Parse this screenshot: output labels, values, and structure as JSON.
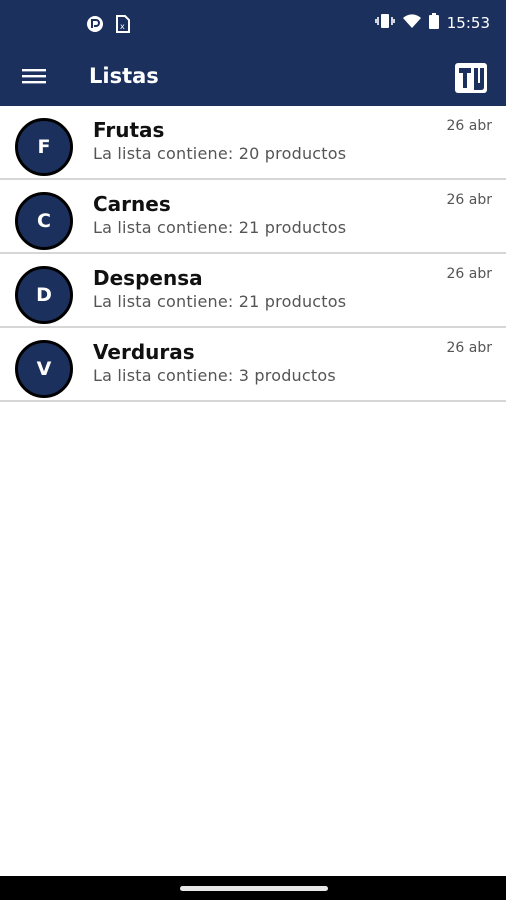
{
  "status_bar": {
    "time": "15:53",
    "icons": [
      "app-notification-icon",
      "sim-card-icon",
      "vibrate-icon",
      "wifi-icon",
      "battery-icon"
    ]
  },
  "app_bar": {
    "title": "Listas",
    "menu_icon": "hamburger-menu-icon",
    "logo_icon": "app-logo-icon",
    "background": "#1c305e"
  },
  "lists": [
    {
      "initial": "F",
      "name": "Frutas",
      "subtitle_prefix": "La lista contiene:",
      "subtitle_count": "20 productos",
      "date": "26 abr"
    },
    {
      "initial": "C",
      "name": "Carnes",
      "subtitle_prefix": "La lista contiene:",
      "subtitle_count": "21 productos",
      "date": "26 abr"
    },
    {
      "initial": "D",
      "name": "Despensa",
      "subtitle_prefix": "La lista contiene:",
      "subtitle_count": "21 productos",
      "date": "26 abr"
    },
    {
      "initial": "V",
      "name": "Verduras",
      "subtitle_prefix": "La lista contiene:",
      "subtitle_count": "3 productos",
      "date": "26 abr"
    }
  ]
}
